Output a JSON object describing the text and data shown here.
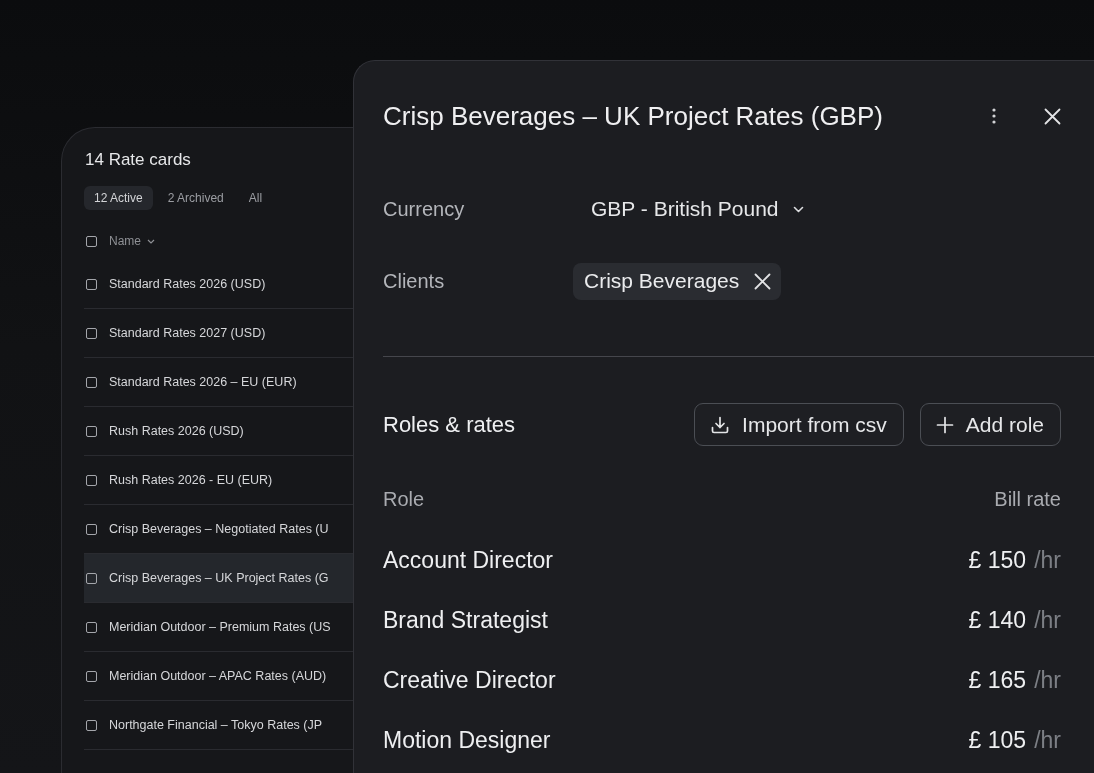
{
  "rate_card_list": {
    "title": "14 Rate cards",
    "tabs": [
      {
        "label": "12 Active",
        "selected": true
      },
      {
        "label": "2 Archived",
        "selected": false
      },
      {
        "label": "All",
        "selected": false
      }
    ],
    "select_all": {
      "checked": false
    },
    "column_header": "Name",
    "rows": [
      {
        "name": "Standard Rates 2026 (USD)",
        "checked": false,
        "selected": false
      },
      {
        "name": "Standard Rates 2027 (USD)",
        "checked": false,
        "selected": false
      },
      {
        "name": "Standard Rates 2026 – EU (EUR)",
        "checked": false,
        "selected": false
      },
      {
        "name": "Rush Rates 2026 (USD)",
        "checked": false,
        "selected": false
      },
      {
        "name": "Rush Rates 2026 - EU (EUR)",
        "checked": false,
        "selected": false
      },
      {
        "name": "Crisp Beverages – Negotiated Rates (U",
        "checked": false,
        "selected": false
      },
      {
        "name": "Crisp Beverages – UK Project Rates (G",
        "checked": false,
        "selected": true
      },
      {
        "name": "Meridian Outdoor – Premium Rates (US",
        "checked": false,
        "selected": false
      },
      {
        "name": "Meridian Outdoor – APAC Rates (AUD)",
        "checked": false,
        "selected": false
      },
      {
        "name": "Northgate Financial – Tokyo Rates (JP",
        "checked": false,
        "selected": false
      }
    ]
  },
  "detail_panel": {
    "title": "Crisp Beverages – UK Project Rates (GBP)",
    "fields": [
      {
        "kind": "select",
        "label": "Currency",
        "value": "GBP - British Pound"
      },
      {
        "kind": "chips",
        "label": "Clients",
        "chips": [
          "Crisp Beverages"
        ]
      }
    ],
    "section": {
      "title": "Roles & rates",
      "buttons": [
        {
          "kind": "import",
          "label": "Import from csv"
        },
        {
          "kind": "add",
          "label": "Add role"
        }
      ],
      "columns": [
        "Role",
        "Bill rate"
      ],
      "rows": [
        {
          "role": "Account Director",
          "rate": "£ 150",
          "unit": "/hr"
        },
        {
          "role": "Brand Strategist",
          "rate": "£ 140",
          "unit": "/hr"
        },
        {
          "role": "Creative Director",
          "rate": "£ 165",
          "unit": "/hr"
        },
        {
          "role": "Motion Designer",
          "rate": "£ 105",
          "unit": "/hr"
        }
      ]
    }
  }
}
